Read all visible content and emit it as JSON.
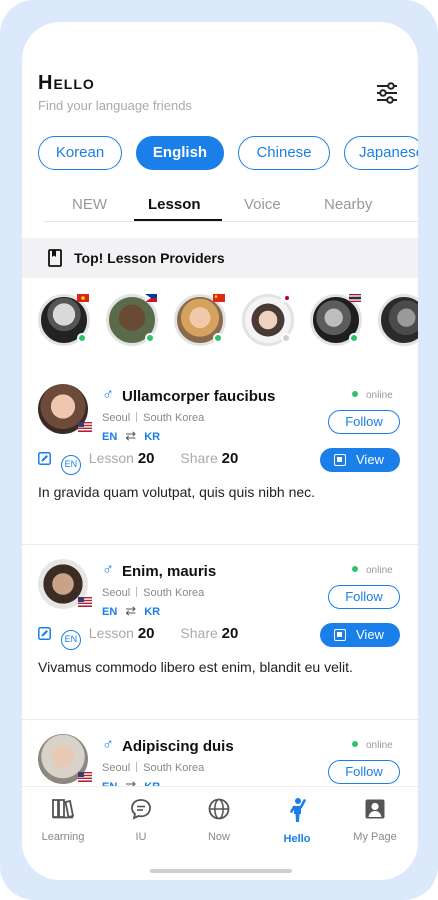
{
  "header": {
    "title": "Hello",
    "subtitle": "Find your language friends",
    "filter_icon": "sliders-icon"
  },
  "language_chips": [
    {
      "label": "Korean",
      "active": false
    },
    {
      "label": "English",
      "active": true
    },
    {
      "label": "Chinese",
      "active": false
    },
    {
      "label": "Japanese",
      "active": false
    }
  ],
  "tabs": [
    {
      "label": "NEW",
      "active": false
    },
    {
      "label": "Lesson",
      "active": true
    },
    {
      "label": "Voice",
      "active": false
    },
    {
      "label": "Nearby",
      "active": false
    }
  ],
  "providers": {
    "title": "Top! Lesson Providers",
    "icon": "bookmark-icon",
    "avatars": [
      {
        "flag": "vietnam",
        "online": true
      },
      {
        "flag": "philippines",
        "online": true
      },
      {
        "flag": "china",
        "online": true
      },
      {
        "flag": "japan",
        "online": false
      },
      {
        "flag": "thailand",
        "online": true
      },
      {
        "flag": "",
        "online": false
      }
    ]
  },
  "cards": [
    {
      "name": "Ullamcorper faucibus",
      "city": "Seoul",
      "country": "South Korea",
      "lang_from": "EN",
      "lang_to": "KR",
      "status": "online",
      "follow_label": "Follow",
      "lang_badge": "EN",
      "lesson_label": "Lesson",
      "lesson_count": "20",
      "share_label": "Share",
      "share_count": "20",
      "view_label": "View",
      "description": "In gravida quam volutpat, quis quis nibh nec."
    },
    {
      "name": "Enim, mauris",
      "city": "Seoul",
      "country": "South Korea",
      "lang_from": "EN",
      "lang_to": "KR",
      "status": "online",
      "follow_label": "Follow",
      "lang_badge": "EN",
      "lesson_label": "Lesson",
      "lesson_count": "20",
      "share_label": "Share",
      "share_count": "20",
      "view_label": "View",
      "description": "Vivamus commodo libero est enim, blandit eu velit."
    },
    {
      "name": "Adipiscing duis",
      "city": "Seoul",
      "country": "South Korea",
      "lang_from": "EN",
      "lang_to": "KR",
      "status": "online",
      "follow_label": "Follow"
    }
  ],
  "bottom_nav": [
    {
      "label": "Learning",
      "icon": "books-icon",
      "active": false
    },
    {
      "label": "IU",
      "icon": "chat-bubble-icon",
      "active": false
    },
    {
      "label": "Now",
      "icon": "globe-icon",
      "active": false
    },
    {
      "label": "Hello",
      "icon": "person-waving-icon",
      "active": true
    },
    {
      "label": "My Page",
      "icon": "profile-card-icon",
      "active": false
    }
  ],
  "colors": {
    "accent": "#1a7fe8",
    "online": "#2ec26a",
    "frame": "#dbe9fb"
  }
}
